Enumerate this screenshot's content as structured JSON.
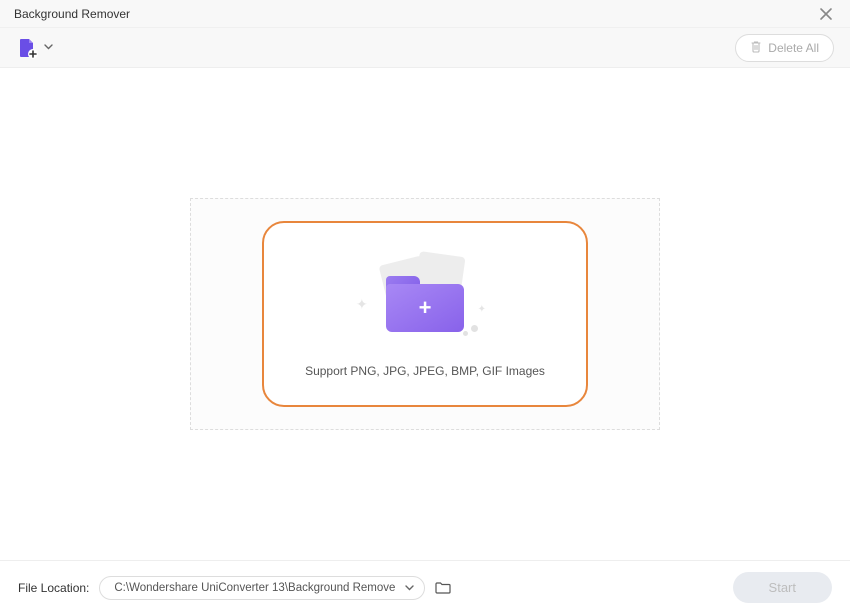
{
  "header": {
    "title": "Background Remover"
  },
  "toolbar": {
    "delete_all_label": "Delete All"
  },
  "dropzone": {
    "support_text": "Support PNG, JPG, JPEG, BMP, GIF Images"
  },
  "footer": {
    "file_location_label": "File Location:",
    "file_location_path": "C:\\Wondershare UniConverter 13\\Background Remove",
    "start_label": "Start"
  }
}
